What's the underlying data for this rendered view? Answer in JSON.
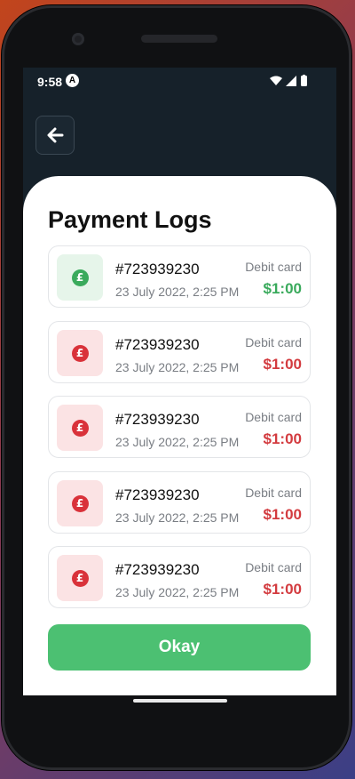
{
  "status_bar": {
    "time": "9:58",
    "app_badge": "A"
  },
  "header": {
    "back_icon": "arrow-left-icon"
  },
  "page": {
    "title": "Payment Logs"
  },
  "colors": {
    "success": "#3aaa5c",
    "danger": "#d33b3f",
    "button": "#4cc072",
    "header_bg": "#16212a"
  },
  "transactions": [
    {
      "ref": "#723939230",
      "date": "23 July 2022, 2:25 PM",
      "method": "Debit card",
      "amount": "$1:00",
      "status": "success",
      "icon": "pound-icon"
    },
    {
      "ref": "#723939230",
      "date": "23 July 2022, 2:25 PM",
      "method": "Debit card",
      "amount": "$1:00",
      "status": "failed",
      "icon": "pound-icon"
    },
    {
      "ref": "#723939230",
      "date": "23 July 2022, 2:25 PM",
      "method": "Debit card",
      "amount": "$1:00",
      "status": "failed",
      "icon": "pound-icon"
    },
    {
      "ref": "#723939230",
      "date": "23 July 2022, 2:25 PM",
      "method": "Debit card",
      "amount": "$1:00",
      "status": "failed",
      "icon": "pound-icon"
    },
    {
      "ref": "#723939230",
      "date": "23 July 2022, 2:25 PM",
      "method": "Debit card",
      "amount": "$1:00",
      "status": "failed",
      "icon": "pound-icon"
    }
  ],
  "actions": {
    "okay_label": "Okay"
  }
}
